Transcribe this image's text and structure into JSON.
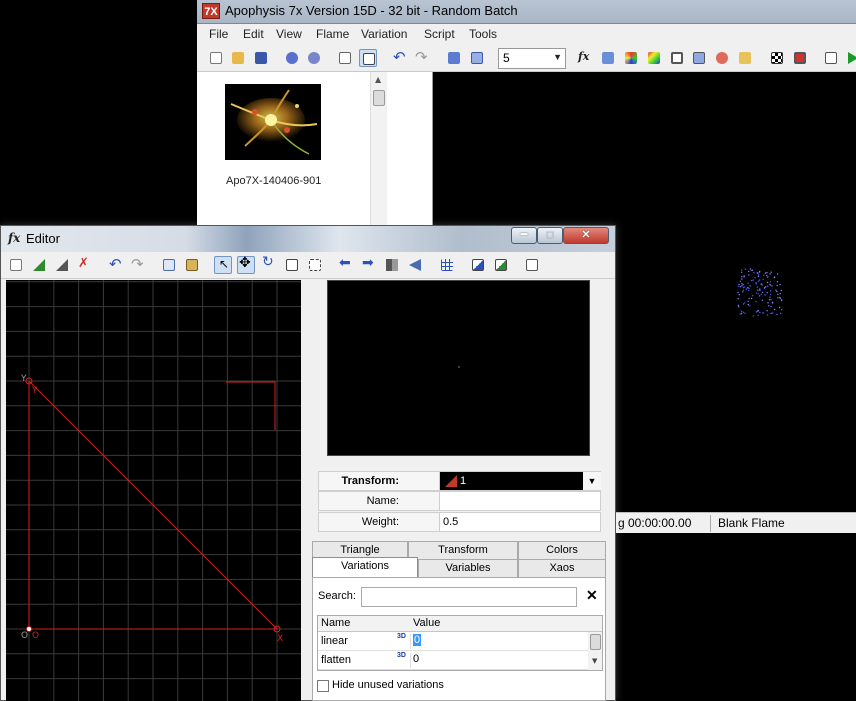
{
  "main_window": {
    "icon_text": "7X",
    "title": "Apophysis 7x Version 15D  - 32 bit - Random Batch",
    "menu": [
      "File",
      "Edit",
      "View",
      "Flame",
      "Variation",
      "Script",
      "Tools"
    ],
    "zoom_value": "5",
    "browser": {
      "items": [
        {
          "label": "Apo7X-140406-901"
        }
      ]
    },
    "status": {
      "time": "g 00:00:00.00",
      "flame_name": "Blank Flame"
    }
  },
  "editor": {
    "icon_text": "fx",
    "title": "Editor",
    "canvas_labels": {
      "y_axis": "Y",
      "y_vertex": "Y",
      "origin_axis": "O",
      "origin_vertex": "O",
      "x_vertex": "X"
    },
    "transform": {
      "label": "Transform:",
      "value": "1",
      "name_label": "Name:",
      "name_value": "",
      "weight_label": "Weight:",
      "weight_value": "0.5"
    },
    "tabs_top": [
      "Triangle",
      "Transform",
      "Colors"
    ],
    "tabs_bottom": [
      "Variations",
      "Variables",
      "Xaos"
    ],
    "variations": {
      "search_label": "Search:",
      "search_value": "",
      "clear_icon": "✕",
      "columns": [
        "Name",
        "Value"
      ],
      "rows": [
        {
          "name": "linear",
          "badge": "3D",
          "value": "0"
        },
        {
          "name": "flatten",
          "badge": "3D",
          "value": "0"
        }
      ],
      "hide_unused_label": "Hide unused variations"
    }
  },
  "colors": {
    "triangle_red": "#d41f1f",
    "grid": "#3a3a3a",
    "selection_blue": "#3399ff"
  }
}
